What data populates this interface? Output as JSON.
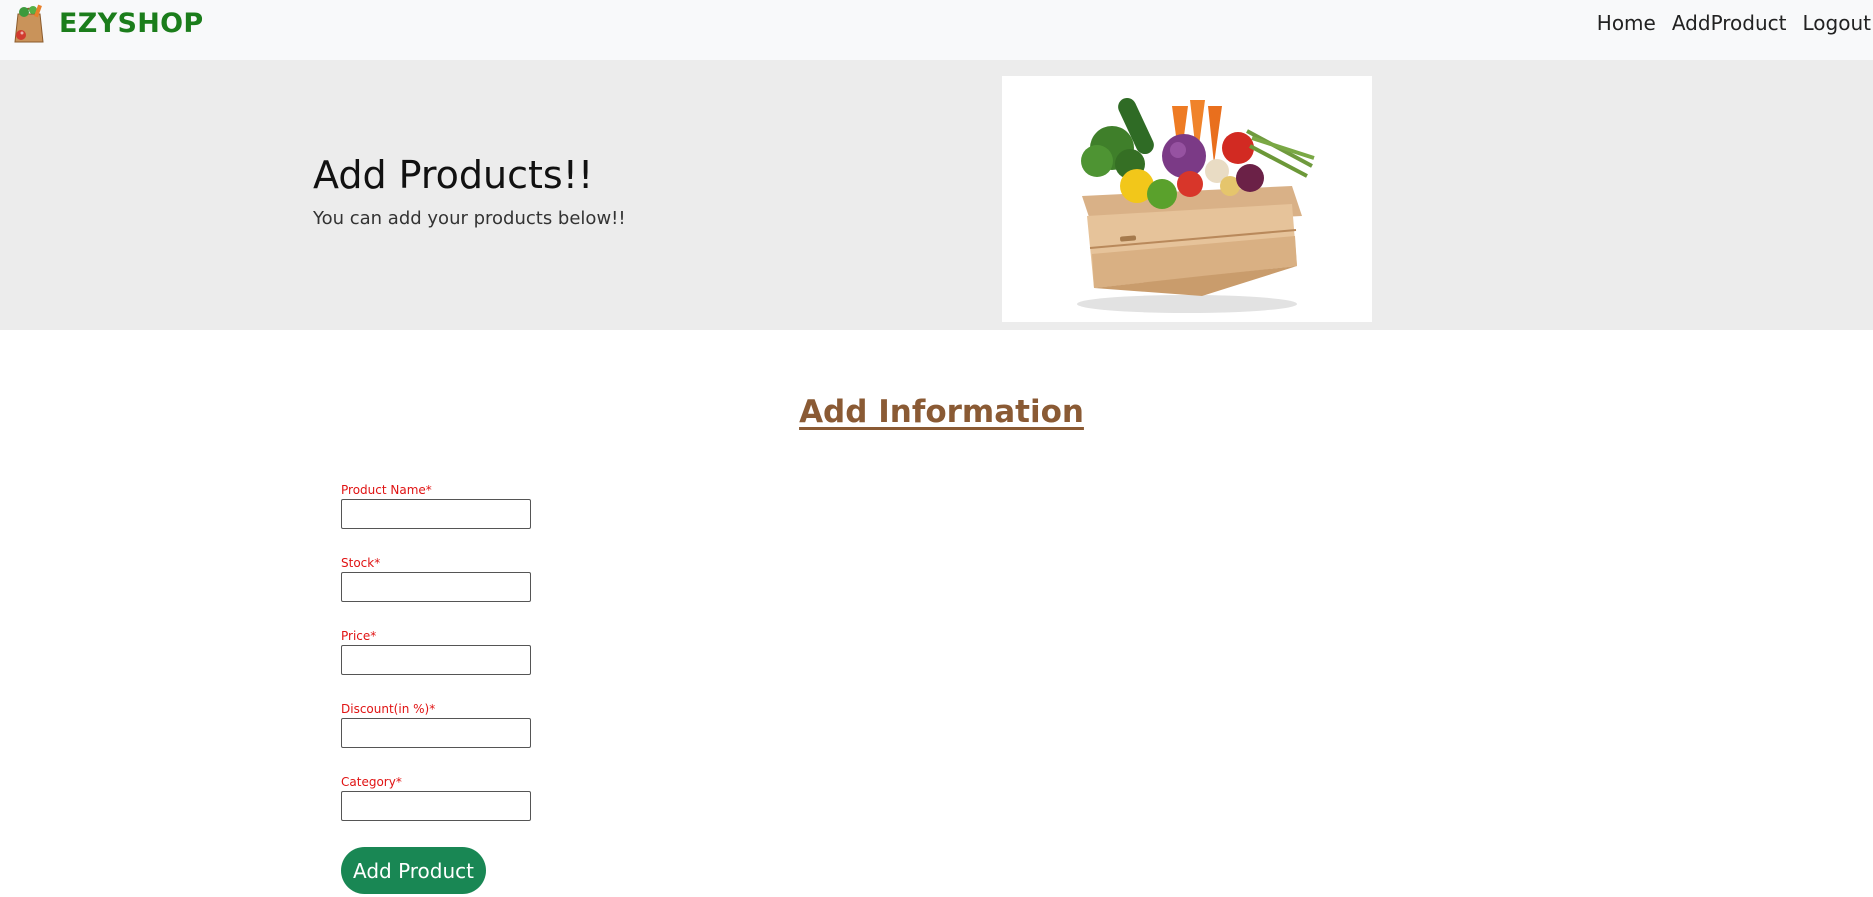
{
  "brand": {
    "name": "EZYSHOP",
    "logo_icon": "grocery-bag-icon"
  },
  "nav": {
    "items": [
      "Home",
      "AddProduct",
      "Logout"
    ]
  },
  "hero": {
    "title": "Add Products!!",
    "subtitle": "You can add your products below!!",
    "image_icon": "vegetable-crate-image"
  },
  "section": {
    "title": "Add Information"
  },
  "form": {
    "fields": [
      {
        "label": "Product Name*",
        "value": ""
      },
      {
        "label": "Stock*",
        "value": ""
      },
      {
        "label": "Price*",
        "value": ""
      },
      {
        "label": "Discount(in %)*",
        "value": ""
      },
      {
        "label": "Category*",
        "value": ""
      }
    ],
    "submit_label": "Add Product"
  },
  "colors": {
    "brand": "#1b7d1b",
    "navbar_bg": "#f8f9fa",
    "hero_bg": "#ececec",
    "section_title": "#8a5a34",
    "required_label": "#e01313",
    "button_bg": "#198754"
  }
}
